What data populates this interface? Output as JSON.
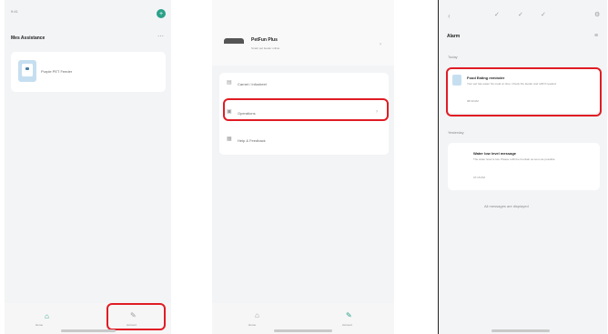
{
  "screen1": {
    "status_time": "9:41",
    "title": "Mes Assistance",
    "device_name": "Purple PET Feeder",
    "nav_home": "Home",
    "nav_account": "Account"
  },
  "screen2": {
    "device_title": "PetFun Plus",
    "device_sub": "Smart pet feeder online",
    "menu_items": [
      "Carnet / Infosheet",
      "Operations",
      "Help & Feedback"
    ],
    "nav_home": "Home",
    "nav_account": "Account"
  },
  "screen3": {
    "title": "Alarm",
    "section1_date": "Today",
    "card1_title": "Food Eating reminder",
    "card1_body": "Your pet has eaten his meal on time. Check the feeder and refill if needed.",
    "card1_time": "08:30 AM",
    "section2_date": "Yesterday",
    "card2_title": "Water low level message",
    "card2_body": "The water level is low. Please refill the fountain as soon as possible.",
    "card2_time": "07:15 PM",
    "footer": "All messages are displayed"
  },
  "colors": {
    "highlight": "#e01c24",
    "accent": "#2aa189",
    "background": "#f3f4f6"
  }
}
